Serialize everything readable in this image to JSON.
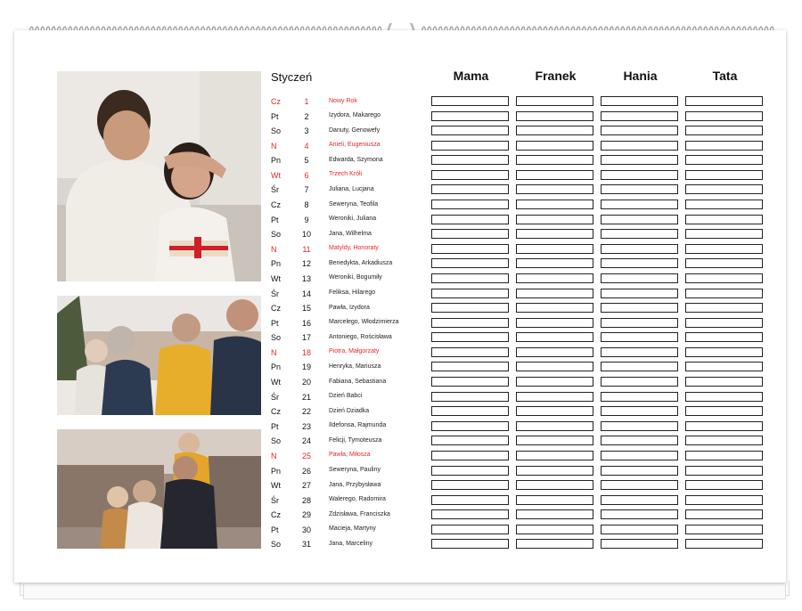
{
  "calendar": {
    "month": "Styczeń",
    "columns": [
      "Mama",
      "Franek",
      "Hania",
      "Tata"
    ],
    "days": [
      {
        "day": "Cz",
        "num": "1",
        "names": "Nowy Rok",
        "red": true
      },
      {
        "day": "Pt",
        "num": "2",
        "names": "Izydora, Makarego",
        "red": false
      },
      {
        "day": "So",
        "num": "3",
        "names": "Danuty, Genowefy",
        "red": false
      },
      {
        "day": "N",
        "num": "4",
        "names": "Anieli, Eugeniusza",
        "red": true
      },
      {
        "day": "Pn",
        "num": "5",
        "names": "Edwarda, Szymona",
        "red": false
      },
      {
        "day": "Wt",
        "num": "6",
        "names": "Trzech Króli",
        "red": true
      },
      {
        "day": "Śr",
        "num": "7",
        "names": "Juliana, Lucjana",
        "red": false
      },
      {
        "day": "Cz",
        "num": "8",
        "names": "Seweryna, Teofila",
        "red": false
      },
      {
        "day": "Pt",
        "num": "9",
        "names": "Weroniki, Juliana",
        "red": false
      },
      {
        "day": "So",
        "num": "10",
        "names": "Jana, Wilhelma",
        "red": false
      },
      {
        "day": "N",
        "num": "11",
        "names": "Matyldy, Honoraty",
        "red": true
      },
      {
        "day": "Pn",
        "num": "12",
        "names": "Benedykta, Arkadiusza",
        "red": false
      },
      {
        "day": "Wt",
        "num": "13",
        "names": "Weroniki, Bogumiły",
        "red": false
      },
      {
        "day": "Śr",
        "num": "14",
        "names": "Feliksa, Hilarego",
        "red": false
      },
      {
        "day": "Cz",
        "num": "15",
        "names": "Pawła, Izydora",
        "red": false
      },
      {
        "day": "Pt",
        "num": "16",
        "names": "Marcelego, Włodzimierza",
        "red": false
      },
      {
        "day": "So",
        "num": "17",
        "names": "Antoniego, Rościsława",
        "red": false
      },
      {
        "day": "N",
        "num": "18",
        "names": "Piotra, Małgorzaty",
        "red": true
      },
      {
        "day": "Pn",
        "num": "19",
        "names": "Henryka, Mariusza",
        "red": false
      },
      {
        "day": "Wt",
        "num": "20",
        "names": "Fabiana, Sebastiana",
        "red": false
      },
      {
        "day": "Śr",
        "num": "21",
        "names": "Dzień Babci",
        "red": false
      },
      {
        "day": "Cz",
        "num": "22",
        "names": "Dzień Dziadka",
        "red": false
      },
      {
        "day": "Pt",
        "num": "23",
        "names": "Ildefonsa, Rajmunda",
        "red": false
      },
      {
        "day": "So",
        "num": "24",
        "names": "Felicji, Tymoteusza",
        "red": false
      },
      {
        "day": "N",
        "num": "25",
        "names": "Pawła, Miłosza",
        "red": true
      },
      {
        "day": "Pn",
        "num": "26",
        "names": "Seweryna, Pauliny",
        "red": false
      },
      {
        "day": "Wt",
        "num": "27",
        "names": "Jana, Przybysława",
        "red": false
      },
      {
        "day": "Śr",
        "num": "28",
        "names": "Walerego, Radomira",
        "red": false
      },
      {
        "day": "Cz",
        "num": "29",
        "names": "Zdzisława, Franciszka",
        "red": false
      },
      {
        "day": "Pt",
        "num": "30",
        "names": "Macieja, Martyny",
        "red": false
      },
      {
        "day": "So",
        "num": "31",
        "names": "Jana, Marceliny",
        "red": false
      }
    ]
  },
  "colors": {
    "holiday": "#e8262c",
    "text": "#111111",
    "page": "#ffffff"
  },
  "photos": [
    "father-daughter-gift-photo",
    "family-winter-hug-photo",
    "family-street-autumn-photo"
  ]
}
